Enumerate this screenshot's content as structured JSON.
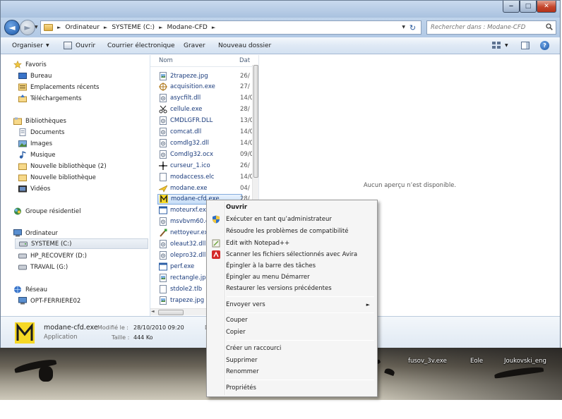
{
  "window": {
    "minimize": "‒",
    "maximize": "□",
    "close": "✕"
  },
  "address": {
    "back_glyph": "◄",
    "forward_glyph": "►",
    "crumbs": [
      "Ordinateur",
      "SYSTEME (C:)",
      "Modane-CFD"
    ],
    "search_placeholder": "Rechercher dans : Modane-CFD"
  },
  "toolbar": {
    "organize": "Organiser",
    "open": "Ouvrir",
    "email": "Courrier électronique",
    "burn": "Graver",
    "new_folder": "Nouveau dossier",
    "help": "?"
  },
  "nav": {
    "favorites": "Favoris",
    "desktop": "Bureau",
    "recent": "Emplacements récents",
    "downloads": "Téléchargements",
    "libraries": "Bibliothèques",
    "documents": "Documents",
    "images": "Images",
    "music": "Musique",
    "newlib2": "Nouvelle bibliothèque (2)",
    "newlib": "Nouvelle bibliothèque",
    "videos": "Vidéos",
    "homegroup": "Groupe résidentiel",
    "computer": "Ordinateur",
    "drive_c": "SYSTEME (C:)",
    "drive_d": "HP_RECOVERY (D:)",
    "drive_g": "TRAVAIL (G:)",
    "network": "Réseau",
    "pc": "OPT-FERRIERE02"
  },
  "columns": {
    "name": "Nom",
    "date": "Dat"
  },
  "files": [
    {
      "name": "2trapeze.jpg",
      "date": "26/",
      "icon": "image-file-icon"
    },
    {
      "name": "acquisition.exe",
      "date": "27/",
      "icon": "crosshair-icon"
    },
    {
      "name": "asycfilt.dll",
      "date": "14/0",
      "icon": "dll-file-icon"
    },
    {
      "name": "cellule.exe",
      "date": "28/",
      "icon": "scissors-icon"
    },
    {
      "name": "CMDLGFR.DLL",
      "date": "13/0",
      "icon": "dll-file-icon"
    },
    {
      "name": "comcat.dll",
      "date": "14/0",
      "icon": "dll-file-icon"
    },
    {
      "name": "comdlg32.dll",
      "date": "14/0",
      "icon": "dll-file-icon"
    },
    {
      "name": "Comdlg32.ocx",
      "date": "09/0",
      "icon": "dll-file-icon"
    },
    {
      "name": "curseur_1.ico",
      "date": "26/",
      "icon": "cursor-crosshair-icon"
    },
    {
      "name": "modaccess.elc",
      "date": "14/0",
      "icon": "generic-file-icon"
    },
    {
      "name": "modane.exe",
      "date": "04/",
      "icon": "plane-icon"
    },
    {
      "name": "modane-cfd.exe",
      "date": "28/",
      "icon": "app-m-icon"
    },
    {
      "name": "moteurxf.exe",
      "date": "",
      "icon": "app-window-icon"
    },
    {
      "name": "msvbvm60.d",
      "date": "",
      "icon": "dll-file-icon"
    },
    {
      "name": "nettoyeur.exe",
      "date": "",
      "icon": "brush-icon"
    },
    {
      "name": "oleaut32.dll",
      "date": "",
      "icon": "dll-file-icon"
    },
    {
      "name": "olepro32.dll",
      "date": "",
      "icon": "dll-file-icon"
    },
    {
      "name": "perf.exe",
      "date": "",
      "icon": "app-window-icon"
    },
    {
      "name": "rectangle.jpg",
      "date": "",
      "icon": "image-file-icon"
    },
    {
      "name": "stdole2.tlb",
      "date": "",
      "icon": "generic-file-icon"
    },
    {
      "name": "trapeze.jpg",
      "date": "",
      "icon": "image-file-icon"
    }
  ],
  "preview": {
    "text": "Aucun aperçu n’est disponible."
  },
  "details": {
    "name": "modane-cfd.exe",
    "type": "Application",
    "modified_label": "Modifié le :",
    "modified_value": "28/10/2010 09:20",
    "size_label": "Taille :",
    "size_value": "444 Ko",
    "cut_label": "D"
  },
  "context_menu": {
    "open": "Ouvrir",
    "run_admin": "Exécuter en tant qu’administrateur",
    "troubleshoot": "Résoudre les problèmes de compatibilité",
    "notepad": "Edit with Notepad++",
    "avira": "Scanner les fichiers sélectionnés avec Avira",
    "pin_taskbar": "Épingler à la barre des tâches",
    "pin_start": "Épingler au menu Démarrer",
    "restore": "Restaurer les versions précédentes",
    "send_to": "Envoyer vers",
    "cut": "Couper",
    "copy": "Copier",
    "shortcut": "Créer un raccourci",
    "delete": "Supprimer",
    "rename": "Renommer",
    "properties": "Propriétés"
  },
  "desktop_icons": [
    "fusov_3v.exe",
    "Eole",
    "Joukovski_eng"
  ]
}
